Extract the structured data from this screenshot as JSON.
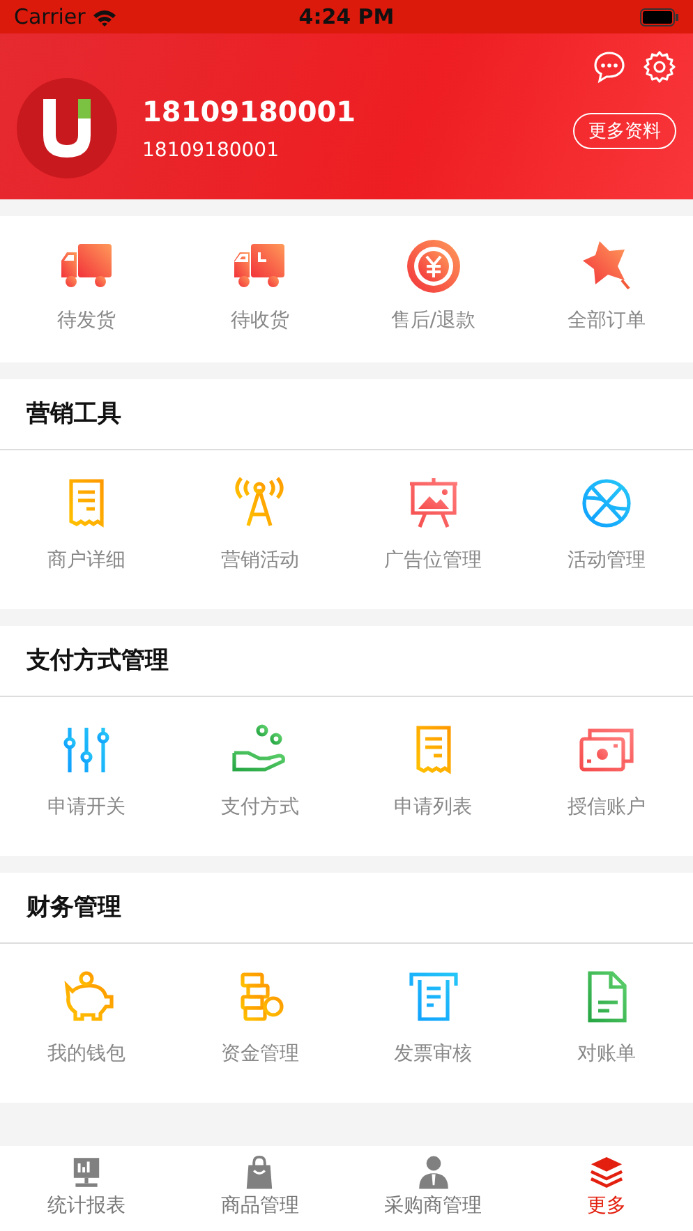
{
  "status_bar": {
    "carrier": "Carrier",
    "time": "4:24 PM"
  },
  "profile": {
    "name": "18109180001",
    "account": "18109180001",
    "more_button": "更多资料"
  },
  "orders": [
    {
      "label": "待发货"
    },
    {
      "label": "待收货"
    },
    {
      "label": "售后/退款"
    },
    {
      "label": "全部订单"
    }
  ],
  "sections": [
    {
      "title": "营销工具",
      "items": [
        {
          "label": "商户详细"
        },
        {
          "label": "营销活动"
        },
        {
          "label": "广告位管理"
        },
        {
          "label": "活动管理"
        }
      ]
    },
    {
      "title": "支付方式管理",
      "items": [
        {
          "label": "申请开关"
        },
        {
          "label": "支付方式"
        },
        {
          "label": "申请列表"
        },
        {
          "label": "授信账户"
        }
      ]
    },
    {
      "title": "财务管理",
      "items": [
        {
          "label": "我的钱包"
        },
        {
          "label": "资金管理"
        },
        {
          "label": "发票审核"
        },
        {
          "label": "对账单"
        }
      ]
    }
  ],
  "tab_bar": [
    {
      "label": "统计报表",
      "selected": false
    },
    {
      "label": "商品管理",
      "selected": false
    },
    {
      "label": "采购商管理",
      "selected": false
    },
    {
      "label": "更多",
      "selected": true
    }
  ]
}
